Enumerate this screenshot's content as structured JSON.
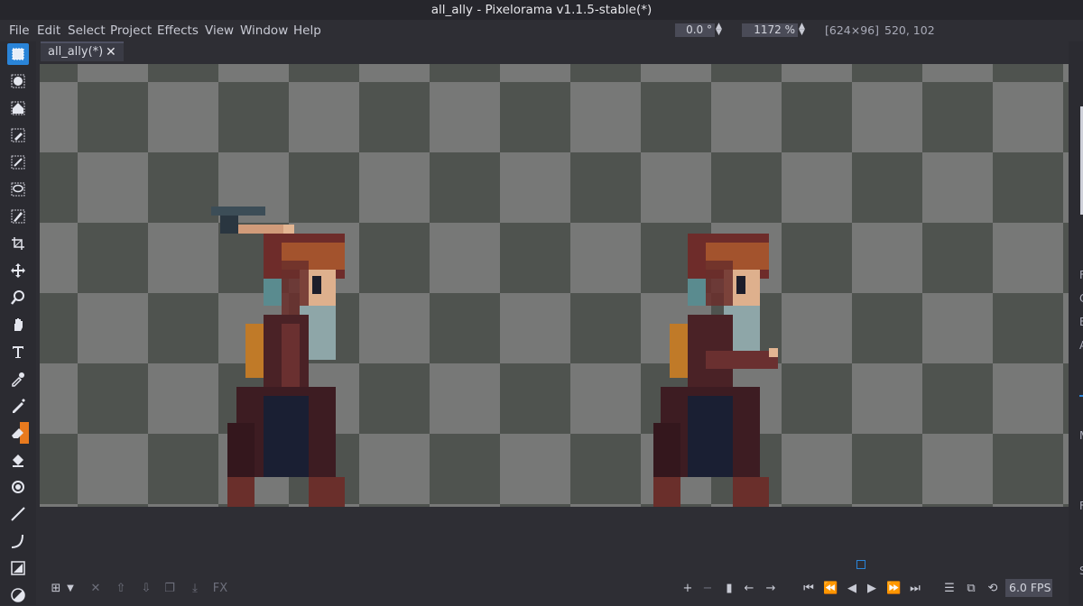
{
  "window": {
    "title": "all_ally - Pixelorama v1.1.5-stable(*)"
  },
  "menu": [
    "File",
    "Edit",
    "Select",
    "Project",
    "Effects",
    "View",
    "Window",
    "Help"
  ],
  "topbar": {
    "rotation_value": "0.0 °",
    "zoom_value": "1172 %",
    "canvas_size": "[624×96]",
    "cursor_position": "520, 102"
  },
  "tools": [
    "rectangle-select",
    "ellipse-select",
    "polygon-select",
    "color-select",
    "magic-wand",
    "lasso",
    "paint-select",
    "crop",
    "move",
    "zoom",
    "pan",
    "text",
    "color-picker",
    "pencil",
    "eraser",
    "bucket",
    "shading",
    "line",
    "curve",
    "rectangle",
    "ellipse"
  ],
  "tabs": [
    {
      "label": "all_ally(*)",
      "close": "✕"
    }
  ],
  "timeline": {
    "fx_label": "FX",
    "fps_value": "6.0 FPS"
  },
  "right_panel_letters": [
    "F",
    "C",
    "E",
    "A",
    "M",
    "F",
    "S"
  ],
  "colors": {
    "left_tool_accent": "#2a84d8",
    "right_tool_accent": "#e87a1e",
    "checker_dark": "#4f534f",
    "checker_light": "#777877"
  }
}
